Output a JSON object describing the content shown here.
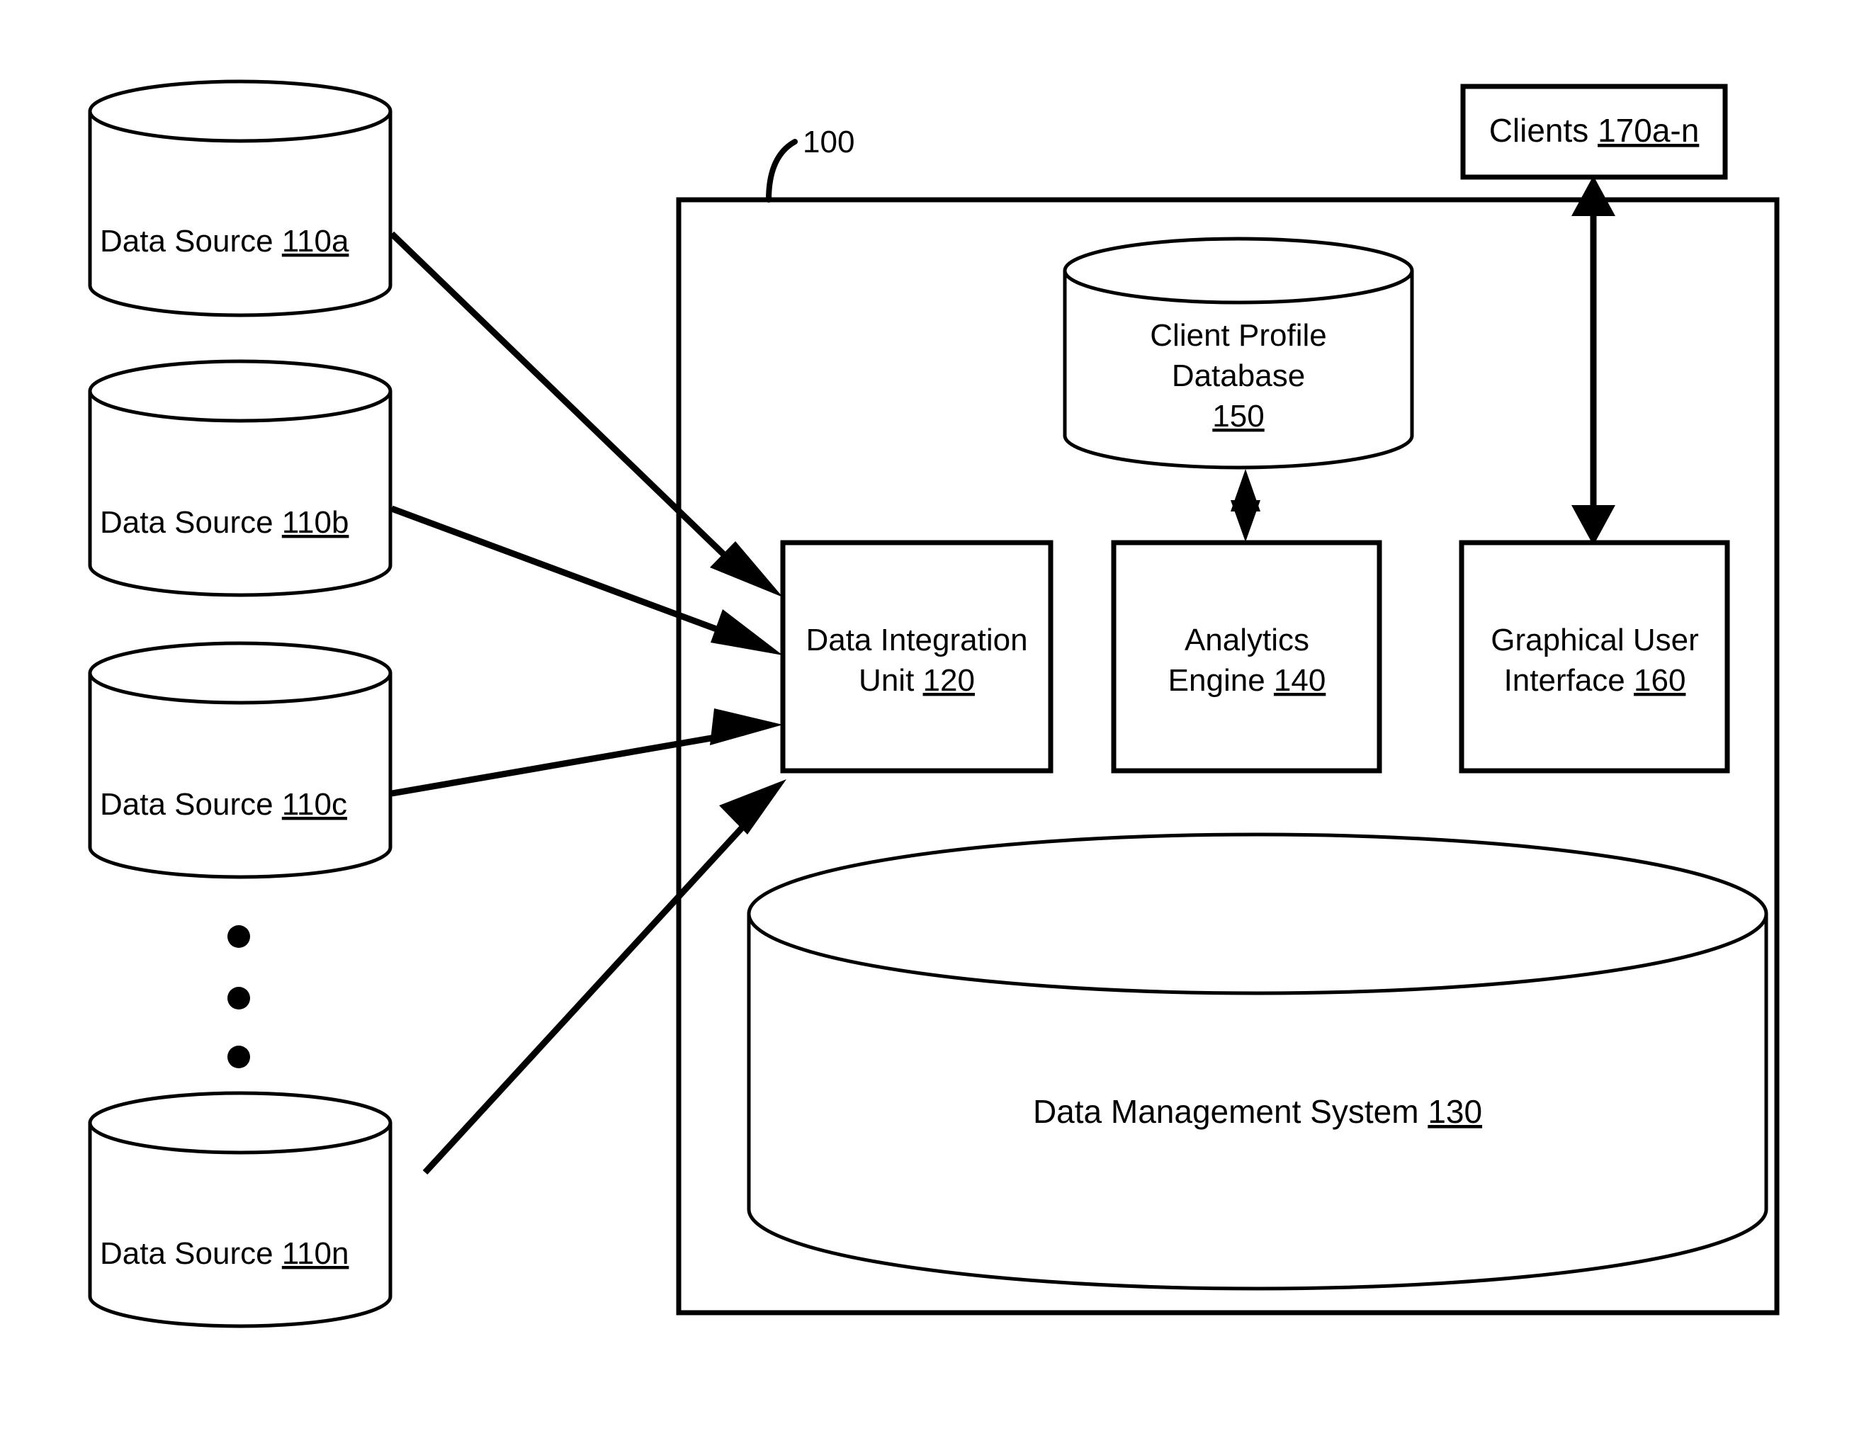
{
  "figure": {
    "reference_numeral": "100",
    "system_boundary_label": "100"
  },
  "data_sources": [
    {
      "name": "Data Source",
      "ref": "110a",
      "full": "Data Source 110a"
    },
    {
      "name": "Data Source",
      "ref": "110b",
      "full": "Data Source 110b"
    },
    {
      "name": "Data Source",
      "ref": "110c",
      "full": "Data Source 110c"
    },
    {
      "name": "Data Source",
      "ref": "110n",
      "full": "Data Source 110n"
    }
  ],
  "ellipsis": {
    "dots": 3,
    "meaning": "vertical-ellipsis-between-110c-and-110n"
  },
  "system_components": {
    "data_integration_unit": {
      "line1": "Data Integration",
      "line2_text": "Unit",
      "ref": "120"
    },
    "analytics_engine": {
      "line1": "Analytics",
      "line2_text": "Engine",
      "ref": "140"
    },
    "graphical_user_interface": {
      "line1": "Graphical User",
      "line2_text": "Interface",
      "ref": "160"
    },
    "client_profile_database": {
      "line1": "Client Profile",
      "line2": "Database",
      "ref": "150"
    },
    "data_management_system": {
      "text": "Data Management System",
      "ref": "130"
    }
  },
  "external_components": {
    "clients": {
      "text": "Clients",
      "ref": "170a-n"
    }
  },
  "connections": [
    {
      "from": "Data Source 110a",
      "to": "Data Integration Unit 120",
      "type": "single-arrow"
    },
    {
      "from": "Data Source 110b",
      "to": "Data Integration Unit 120",
      "type": "single-arrow"
    },
    {
      "from": "Data Source 110c",
      "to": "Data Integration Unit 120",
      "type": "single-arrow"
    },
    {
      "from": "Data Source 110n",
      "to": "Data Integration Unit 120",
      "type": "single-arrow"
    },
    {
      "from": "Client Profile Database 150",
      "to": "Analytics Engine 140",
      "type": "double-arrow"
    },
    {
      "from": "Clients 170a-n",
      "to": "Graphical User Interface 160",
      "type": "double-arrow"
    }
  ],
  "colors": {
    "stroke": "#000000",
    "fill": "#ffffff",
    "background": "#ffffff"
  }
}
